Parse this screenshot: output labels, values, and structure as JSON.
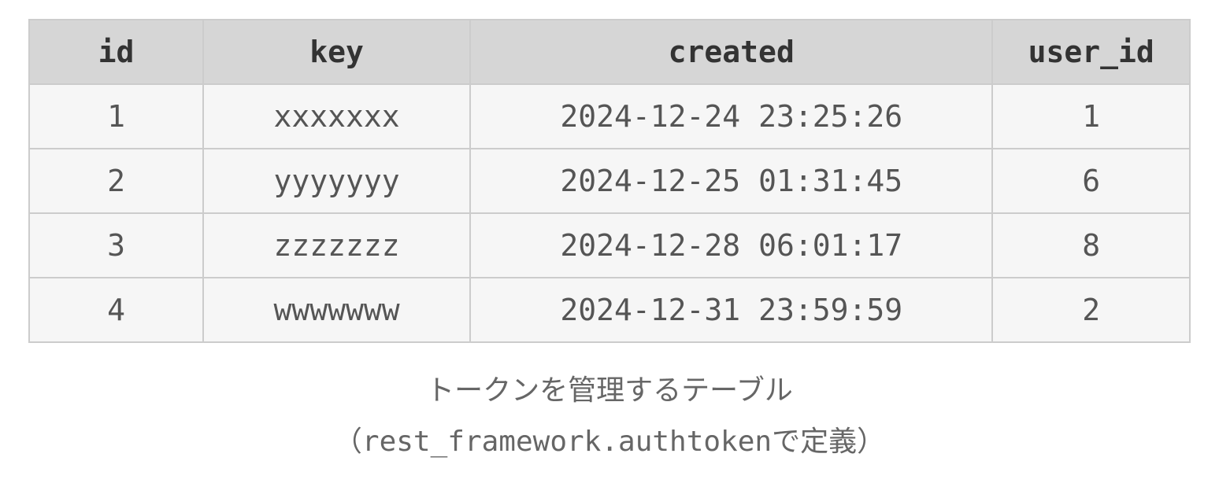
{
  "table": {
    "columns": [
      "id",
      "key",
      "created",
      "user_id"
    ],
    "rows": [
      {
        "id": "1",
        "key": "xxxxxxx",
        "created": "2024-12-24 23:25:26",
        "user_id": "1"
      },
      {
        "id": "2",
        "key": "yyyyyyy",
        "created": "2024-12-25 01:31:45",
        "user_id": "6"
      },
      {
        "id": "3",
        "key": "zzzzzzz",
        "created": "2024-12-28 06:01:17",
        "user_id": "8"
      },
      {
        "id": "4",
        "key": "wwwwwww",
        "created": "2024-12-31 23:59:59",
        "user_id": "2"
      }
    ]
  },
  "caption": {
    "line1": "トークンを管理するテーブル",
    "line2_open": "（",
    "line2_mono": "rest_framework.authtoken",
    "line2_tail": "で定義）"
  }
}
